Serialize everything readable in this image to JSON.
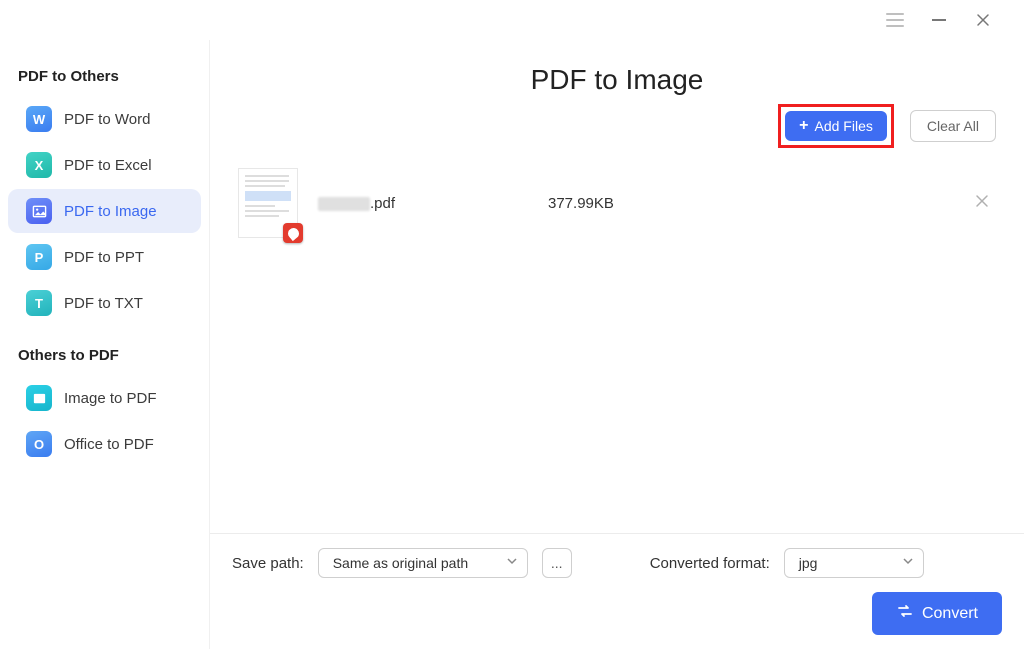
{
  "window": {
    "title": ""
  },
  "sidebar": {
    "section1": "PDF to Others",
    "section2": "Others to PDF",
    "items": [
      {
        "label": "PDF to Word",
        "iconLetter": "W"
      },
      {
        "label": "PDF to Excel",
        "iconLetter": "X"
      },
      {
        "label": "PDF to Image",
        "iconLetter": ""
      },
      {
        "label": "PDF to PPT",
        "iconLetter": "P"
      },
      {
        "label": "PDF to TXT",
        "iconLetter": "T"
      }
    ],
    "items2": [
      {
        "label": "Image to PDF",
        "iconLetter": ""
      },
      {
        "label": "Office to PDF",
        "iconLetter": "O"
      }
    ],
    "activeIndex": 2
  },
  "main": {
    "title": "PDF to Image",
    "addFiles": "Add Files",
    "clearAll": "Clear All"
  },
  "files": [
    {
      "nameSuffix": ".pdf",
      "size": "377.99KB"
    }
  ],
  "footer": {
    "savePathLabel": "Save path:",
    "savePathValue": "Same as original path",
    "browseLabel": "...",
    "formatLabel": "Converted format:",
    "formatValue": "jpg",
    "convertLabel": "Convert"
  }
}
